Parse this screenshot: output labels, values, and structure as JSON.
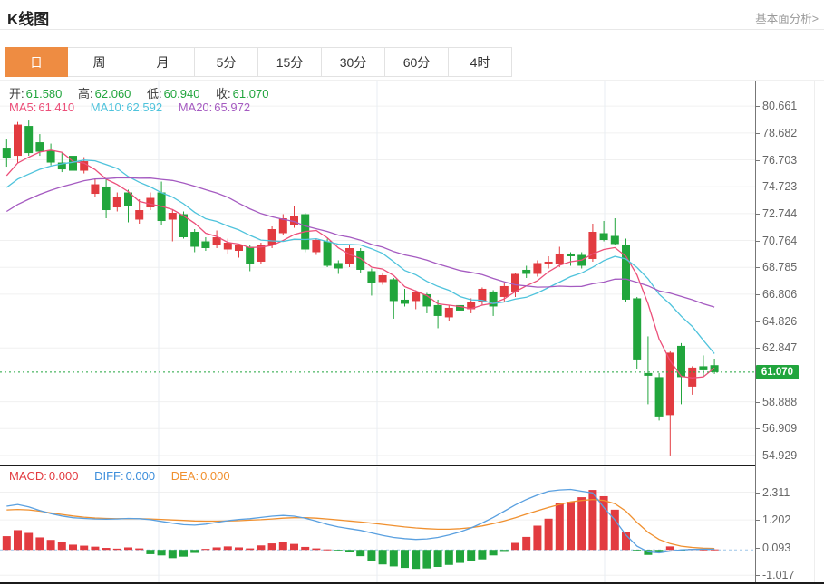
{
  "header": {
    "title": "K线图",
    "link_label": "基本面分析>"
  },
  "tabs": {
    "active_index": 0,
    "items": [
      "日",
      "周",
      "月",
      "5分",
      "15分",
      "30分",
      "60分",
      "4时"
    ]
  },
  "main_chart": {
    "ohlc": {
      "open_label": "开:",
      "open": "61.580",
      "high_label": "高:",
      "high": "62.060",
      "low_label": "低:",
      "low": "60.940",
      "close_label": "收:",
      "close": "61.070"
    },
    "ma": {
      "ma5_label": "MA5:",
      "ma5": "61.410",
      "ma10_label": "MA10:",
      "ma10": "62.592",
      "ma20_label": "MA20:",
      "ma20": "65.972"
    },
    "current_price_label": "61.070"
  },
  "macd_legend": {
    "macd_label": "MACD:",
    "macd_value": "0.000",
    "diff_label": "DIFF:",
    "diff_value": "0.000",
    "dea_label": "DEA:",
    "dea_value": "0.000"
  },
  "colors": {
    "up_red": "#e23b40",
    "down_green": "#21a53c",
    "ma5_pink": "#ec4f79",
    "ma10_cyan": "#4fc3dc",
    "ma20_purple": "#a55bc1",
    "diff_blue": "#5aa0e0",
    "dea_orange": "#f0902f",
    "badge_green": "#21a53d",
    "dotted_price_line": "#21a53d",
    "zero_dash_blue": "#9ec5e8",
    "tab_active_orange": "#ee8c42",
    "grid_h": "#f0f0f0",
    "grid_v": "#e9eef3",
    "ohlc_value_green": "#21a53d"
  },
  "chart_data": [
    {
      "type": "candlestick",
      "title": "K线图 (日K)",
      "legend_entries": [
        "MA5",
        "MA10",
        "MA20"
      ],
      "y_ticks": [
        80.661,
        78.682,
        76.703,
        74.723,
        72.744,
        70.764,
        68.785,
        66.806,
        64.826,
        62.847,
        58.888,
        56.909,
        54.929
      ],
      "ylim": [
        54.19,
        82.54
      ],
      "current_price": 61.07,
      "grid_vertical_x": [
        175,
        416,
        667
      ],
      "x0": 7.3,
      "dx": 12.2,
      "ma_windows": [
        5,
        10,
        20
      ],
      "ma_prehistory_closes": [
        68.5,
        69.0,
        69.5,
        70.0,
        70.5,
        71.0,
        71.5,
        72.0,
        72.3,
        72.6,
        72.9,
        73.2,
        73.5,
        73.8,
        74.1,
        74.4,
        74.7,
        75.0,
        75.4,
        75.8
      ],
      "candles_ohlc": [
        [
          77.6,
          78.2,
          76.2,
          76.8
        ],
        [
          77.0,
          79.5,
          76.5,
          79.3
        ],
        [
          79.2,
          79.6,
          77.0,
          77.2
        ],
        [
          78.0,
          78.6,
          77.0,
          77.3
        ],
        [
          77.4,
          77.9,
          76.3,
          76.5
        ],
        [
          76.5,
          77.2,
          75.8,
          76.0
        ],
        [
          77.0,
          77.4,
          75.6,
          75.9
        ],
        [
          75.9,
          76.9,
          75.7,
          76.6
        ],
        [
          74.2,
          75.3,
          74.0,
          74.9
        ],
        [
          74.7,
          75.3,
          72.4,
          73.0
        ],
        [
          73.2,
          74.3,
          72.9,
          74.0
        ],
        [
          74.3,
          74.5,
          72.1,
          73.3
        ],
        [
          72.3,
          73.8,
          72.0,
          73.0
        ],
        [
          73.2,
          74.3,
          73.0,
          73.9
        ],
        [
          74.3,
          75.1,
          71.9,
          72.2
        ],
        [
          72.3,
          73.0,
          70.7,
          72.8
        ],
        [
          72.7,
          72.9,
          70.9,
          71.0
        ],
        [
          71.4,
          71.6,
          69.9,
          70.3
        ],
        [
          70.7,
          71.0,
          70.0,
          70.2
        ],
        [
          70.4,
          71.5,
          70.2,
          71.0
        ],
        [
          70.1,
          70.9,
          69.8,
          70.6
        ],
        [
          70.0,
          70.5,
          69.5,
          70.4
        ],
        [
          70.3,
          70.4,
          68.5,
          69.0
        ],
        [
          69.2,
          70.6,
          69.0,
          70.4
        ],
        [
          70.4,
          71.8,
          70.2,
          71.6
        ],
        [
          71.3,
          72.7,
          71.2,
          72.4
        ],
        [
          71.9,
          73.3,
          71.7,
          72.6
        ],
        [
          72.7,
          72.8,
          69.9,
          70.1
        ],
        [
          69.9,
          70.9,
          69.7,
          70.8
        ],
        [
          70.7,
          70.9,
          68.8,
          68.9
        ],
        [
          69.1,
          69.3,
          68.3,
          68.7
        ],
        [
          69.0,
          70.4,
          68.8,
          70.2
        ],
        [
          70.0,
          70.2,
          68.4,
          68.6
        ],
        [
          68.5,
          68.7,
          66.7,
          67.6
        ],
        [
          67.7,
          68.4,
          67.5,
          68.2
        ],
        [
          67.9,
          68.0,
          65.0,
          66.3
        ],
        [
          66.4,
          67.2,
          65.9,
          66.1
        ],
        [
          66.3,
          67.1,
          65.7,
          67.0
        ],
        [
          66.8,
          66.9,
          65.4,
          65.9
        ],
        [
          66.0,
          66.4,
          64.3,
          65.2
        ],
        [
          65.1,
          66.0,
          64.8,
          65.8
        ],
        [
          66.0,
          66.3,
          65.3,
          65.6
        ],
        [
          65.7,
          66.5,
          65.4,
          66.2
        ],
        [
          66.2,
          67.3,
          66.0,
          67.2
        ],
        [
          67.0,
          67.1,
          65.2,
          65.9
        ],
        [
          66.6,
          67.6,
          66.2,
          67.4
        ],
        [
          67.0,
          68.4,
          66.6,
          68.3
        ],
        [
          68.6,
          68.9,
          68.0,
          68.3
        ],
        [
          68.3,
          69.3,
          68.1,
          69.1
        ],
        [
          69.0,
          69.6,
          68.7,
          69.2
        ],
        [
          69.0,
          70.3,
          68.8,
          69.8
        ],
        [
          69.8,
          69.9,
          68.9,
          69.6
        ],
        [
          69.7,
          69.9,
          68.7,
          68.9
        ],
        [
          69.4,
          72.0,
          69.2,
          71.4
        ],
        [
          71.3,
          72.2,
          70.7,
          70.8
        ],
        [
          71.1,
          72.4,
          70.4,
          70.5
        ],
        [
          70.4,
          70.9,
          66.2,
          66.4
        ],
        [
          66.5,
          66.6,
          61.3,
          62.0
        ],
        [
          61.0,
          63.7,
          58.7,
          60.8
        ],
        [
          60.7,
          61.0,
          57.5,
          57.8
        ],
        [
          57.9,
          62.6,
          54.93,
          62.5
        ],
        [
          63.0,
          63.2,
          58.7,
          60.7
        ],
        [
          60.0,
          61.5,
          59.4,
          61.4
        ],
        [
          61.5,
          62.3,
          60.7,
          61.2
        ],
        [
          61.58,
          62.06,
          60.94,
          61.07
        ]
      ]
    },
    {
      "type": "bar",
      "title": "MACD",
      "legend_entries": [
        "MACD",
        "DIFF",
        "DEA"
      ],
      "y_ticks": [
        2.311,
        1.202,
        0.093,
        -1.017
      ],
      "vlim": [
        -1.37,
        3.31
      ],
      "grid_vertical_x": [
        175,
        416,
        667
      ],
      "histogram": [
        0.55,
        0.79,
        0.68,
        0.5,
        0.4,
        0.33,
        0.21,
        0.17,
        0.13,
        0.08,
        0.05,
        0.1,
        0.06,
        -0.17,
        -0.22,
        -0.33,
        -0.27,
        -0.12,
        0.04,
        0.1,
        0.14,
        0.1,
        0.06,
        0.18,
        0.26,
        0.3,
        0.24,
        0.12,
        0.06,
        0.02,
        -0.04,
        -0.1,
        -0.25,
        -0.45,
        -0.58,
        -0.66,
        -0.72,
        -0.76,
        -0.74,
        -0.68,
        -0.6,
        -0.52,
        -0.45,
        -0.38,
        -0.22,
        -0.08,
        0.28,
        0.52,
        0.97,
        1.25,
        1.86,
        1.93,
        2.11,
        2.4,
        2.15,
        1.61,
        0.72,
        -0.05,
        -0.2,
        -0.12,
        0.14,
        -0.06,
        0.04,
        0.02,
        0.02
      ],
      "diff_line": [
        1.75,
        1.82,
        1.72,
        1.58,
        1.45,
        1.36,
        1.29,
        1.26,
        1.24,
        1.23,
        1.24,
        1.26,
        1.25,
        1.21,
        1.14,
        1.07,
        1.01,
        0.99,
        1.03,
        1.1,
        1.17,
        1.22,
        1.25,
        1.3,
        1.35,
        1.38,
        1.35,
        1.27,
        1.15,
        1.02,
        0.92,
        0.85,
        0.78,
        0.68,
        0.58,
        0.5,
        0.45,
        0.42,
        0.44,
        0.5,
        0.6,
        0.72,
        0.88,
        1.08,
        1.3,
        1.55,
        1.8,
        2.02,
        2.2,
        2.35,
        2.4,
        2.42,
        2.35,
        2.28,
        1.7,
        1.2,
        0.6,
        0.15,
        -0.08,
        -0.12,
        -0.05,
        0.0,
        0.02,
        0.03,
        0.03
      ],
      "dea_line": [
        1.6,
        1.62,
        1.6,
        1.55,
        1.48,
        1.42,
        1.36,
        1.31,
        1.28,
        1.26,
        1.25,
        1.25,
        1.25,
        1.24,
        1.22,
        1.2,
        1.18,
        1.16,
        1.15,
        1.15,
        1.16,
        1.17,
        1.19,
        1.21,
        1.24,
        1.27,
        1.29,
        1.29,
        1.27,
        1.24,
        1.2,
        1.16,
        1.12,
        1.07,
        1.02,
        0.97,
        0.92,
        0.88,
        0.85,
        0.83,
        0.83,
        0.85,
        0.89,
        0.96,
        1.05,
        1.16,
        1.29,
        1.43,
        1.57,
        1.7,
        1.82,
        1.92,
        1.98,
        2.02,
        1.98,
        1.85,
        1.55,
        1.1,
        0.7,
        0.42,
        0.25,
        0.15,
        0.1,
        0.07,
        0.06
      ]
    }
  ]
}
